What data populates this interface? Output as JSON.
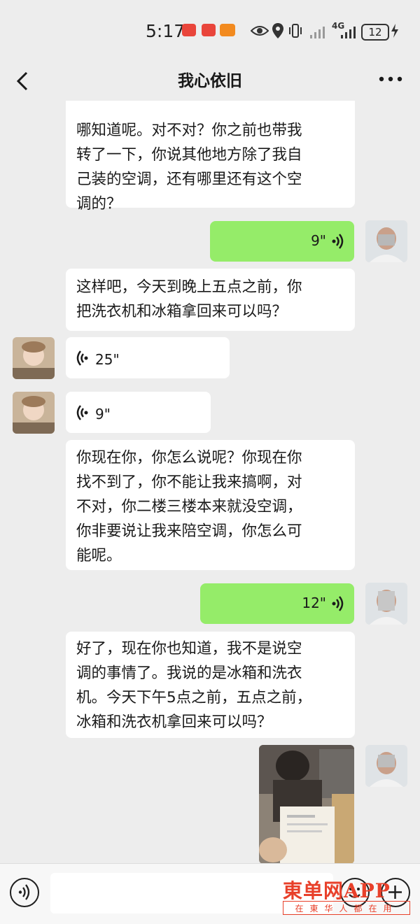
{
  "status_bar": {
    "time": "5:17",
    "network": "4G",
    "battery": "12"
  },
  "header": {
    "title": "我心依旧"
  },
  "messages": [
    {
      "type": "text",
      "side": "in",
      "lines": [
        "哪知道呢。对不对？你之前也带我",
        "转了一下，你说其他地方除了我自",
        "己装的空调，还有哪里还有这个空",
        "调的？"
      ]
    },
    {
      "type": "voice",
      "side": "out",
      "duration": "9\""
    },
    {
      "type": "text",
      "side": "in",
      "lines": [
        "这样吧，今天到晚上五点之前，你",
        "把洗衣机和冰箱拿回来可以吗？"
      ]
    },
    {
      "type": "voice",
      "side": "in",
      "duration": "25\""
    },
    {
      "type": "voice",
      "side": "in",
      "duration": "9\""
    },
    {
      "type": "text",
      "side": "in",
      "lines": [
        "你现在你，你怎么说呢？你现在你",
        "找不到了，你不能让我来搞啊，对",
        "不对，你二楼三楼本来就没空调，",
        "你非要说让我来陪空调，你怎么可",
        "能呢。"
      ]
    },
    {
      "type": "voice",
      "side": "out",
      "duration": "12\""
    },
    {
      "type": "text",
      "side": "in",
      "lines": [
        "好了，现在你也知道，我不是说空",
        "调的事情了。我说的是冰箱和洗衣",
        "机。今天下午5点之前，五点之前，",
        "冰箱和洗衣机拿回来可以吗？"
      ]
    },
    {
      "type": "image",
      "side": "out"
    }
  ],
  "watermark": {
    "title": "東单网APP",
    "subtitle": "在東华人都在用"
  },
  "colors": {
    "background": "#ededed",
    "outgoing_bubble": "#95ec69",
    "incoming_bubble": "#ffffff",
    "watermark": "#e8402a"
  },
  "icons": [
    "back-arrow-icon",
    "more-dots-icon",
    "voice-wave-icon",
    "voice-toggle-icon",
    "emoji-icon",
    "plus-icon"
  ]
}
